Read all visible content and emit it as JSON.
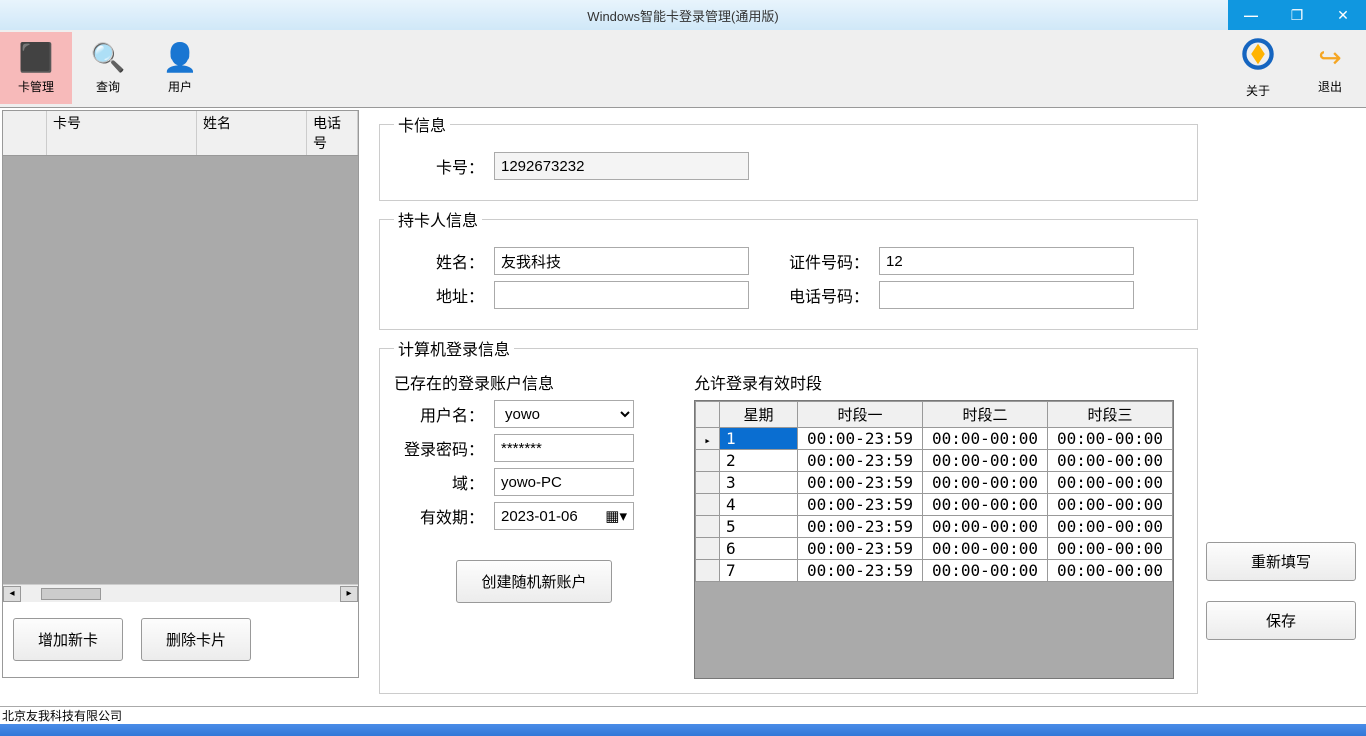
{
  "window": {
    "title": "Windows智能卡登录管理(通用版)"
  },
  "toolbar": {
    "card_mgmt": "卡管理",
    "query": "查询",
    "user": "用户",
    "about": "关于",
    "exit": "退出"
  },
  "left_grid": {
    "col_card": "卡号",
    "col_name": "姓名",
    "col_phone": "电话号"
  },
  "left_btns": {
    "add": "增加新卡",
    "del": "删除卡片"
  },
  "card_info": {
    "legend": "卡信息",
    "card_no_lbl": "卡号：",
    "card_no": "1292673232"
  },
  "holder": {
    "legend": "持卡人信息",
    "name_lbl": "姓名：",
    "name": "友我科技",
    "id_lbl": "证件号码：",
    "id": "12",
    "addr_lbl": "地址：",
    "addr": "",
    "phone_lbl": "电话号码：",
    "phone": ""
  },
  "login": {
    "legend": "计算机登录信息",
    "existing": "已存在的登录账户信息",
    "user_lbl": "用户名：",
    "user": "yowo",
    "pwd_lbl": "登录密码：",
    "pwd": "*******",
    "domain_lbl": "域：",
    "domain": "yowo-PC",
    "expire_lbl": "有效期：",
    "expire": "2023-01-06",
    "create_btn": "创建随机新账户",
    "period_title": "允许登录有效时段",
    "cols": {
      "day": "星期",
      "p1": "时段一",
      "p2": "时段二",
      "p3": "时段三"
    },
    "rows": [
      {
        "d": "1",
        "p1": "00:00-23:59",
        "p2": "00:00-00:00",
        "p3": "00:00-00:00"
      },
      {
        "d": "2",
        "p1": "00:00-23:59",
        "p2": "00:00-00:00",
        "p3": "00:00-00:00"
      },
      {
        "d": "3",
        "p1": "00:00-23:59",
        "p2": "00:00-00:00",
        "p3": "00:00-00:00"
      },
      {
        "d": "4",
        "p1": "00:00-23:59",
        "p2": "00:00-00:00",
        "p3": "00:00-00:00"
      },
      {
        "d": "5",
        "p1": "00:00-23:59",
        "p2": "00:00-00:00",
        "p3": "00:00-00:00"
      },
      {
        "d": "6",
        "p1": "00:00-23:59",
        "p2": "00:00-00:00",
        "p3": "00:00-00:00"
      },
      {
        "d": "7",
        "p1": "00:00-23:59",
        "p2": "00:00-00:00",
        "p3": "00:00-00:00"
      }
    ]
  },
  "side": {
    "reset": "重新填写",
    "save": "保存"
  },
  "status": "北京友我科技有限公司"
}
